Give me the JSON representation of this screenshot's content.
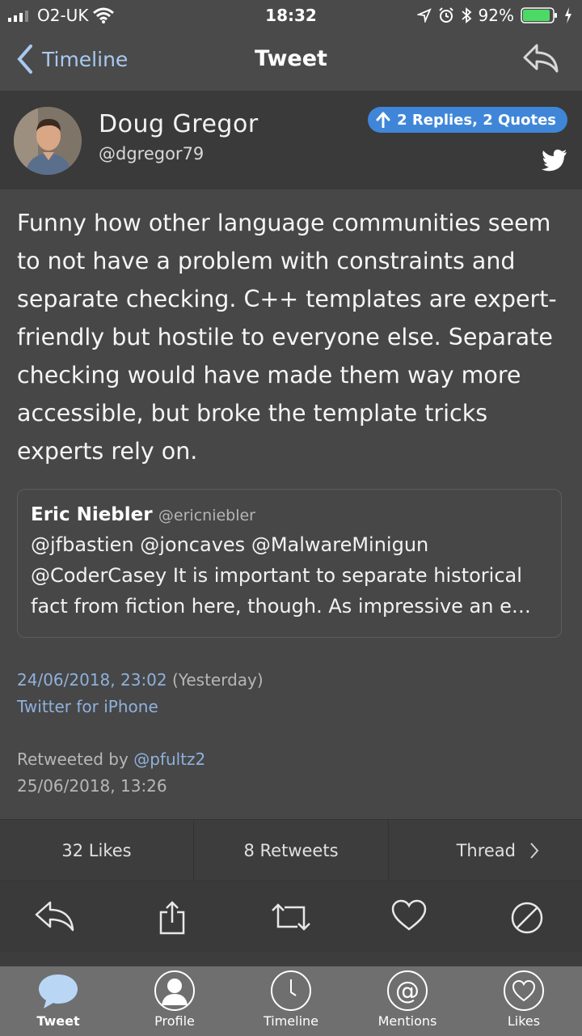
{
  "status": {
    "carrier": "O2-UK",
    "time": "18:32",
    "battery": "92%"
  },
  "nav": {
    "back_label": "Timeline",
    "title": "Tweet"
  },
  "tweet": {
    "author_name": "Doug Gregor",
    "author_handle": "@dgregor79",
    "replies_badge": "2 Replies, 2 Quotes",
    "text": "Funny how other language communities seem to not have a problem with constraints and separate checking. C++ templates are expert-friendly but hostile to everyone else. Separate checking would have made them way more accessible, but broke the template tricks experts rely on.",
    "quote": {
      "name": "Eric Niebler",
      "handle": "@ericniebler",
      "text": "@jfbastien @joncaves @MalwareMinigun @CoderCasey It is important to separate historical fact from fiction here, though. As impressive an e…"
    },
    "date": "24/06/2018, 23:02",
    "relative": "(Yesterday)",
    "client": "Twitter for iPhone",
    "retweeted_prefix": "Retweeted by",
    "retweeted_by": "@pfultz2",
    "retweet_date": "25/06/2018, 13:26"
  },
  "stats": {
    "likes": "32 Likes",
    "retweets": "8 Retweets",
    "thread": "Thread"
  },
  "tabs": [
    "Tweet",
    "Profile",
    "Timeline",
    "Mentions",
    "Likes"
  ],
  "colors": {
    "accent": "#3f86d9",
    "link": "#8fb1dc",
    "background": "#474747"
  }
}
